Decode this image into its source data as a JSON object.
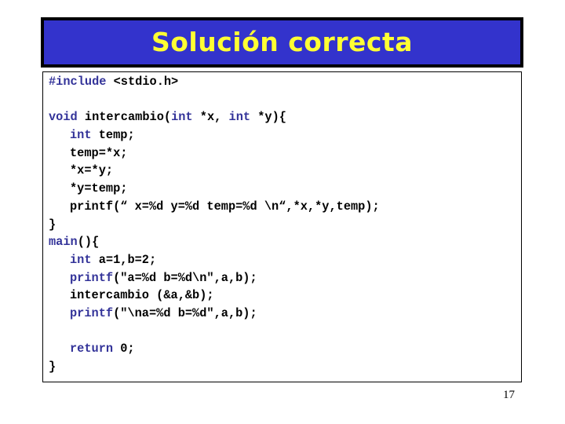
{
  "slide": {
    "title": "Solución correcta",
    "page_number": "17",
    "colors": {
      "title_background": "#3333cc",
      "title_text": "#ffff33",
      "keyword": "#333399",
      "code_text": "#000000"
    }
  },
  "code": {
    "lines": [
      {
        "indent": 0,
        "tokens": [
          {
            "text": "#include",
            "kw": true
          },
          {
            "text": " <stdio.h>",
            "kw": false
          }
        ]
      },
      {
        "indent": 0,
        "tokens": []
      },
      {
        "indent": 0,
        "tokens": [
          {
            "text": "void",
            "kw": true
          },
          {
            "text": " intercambio(",
            "kw": false
          },
          {
            "text": "int",
            "kw": true
          },
          {
            "text": " *x, ",
            "kw": false
          },
          {
            "text": "int",
            "kw": true
          },
          {
            "text": " *y){",
            "kw": false
          }
        ]
      },
      {
        "indent": 1,
        "tokens": [
          {
            "text": "int",
            "kw": true
          },
          {
            "text": " temp;",
            "kw": false
          }
        ]
      },
      {
        "indent": 1,
        "tokens": [
          {
            "text": "temp=*x;",
            "kw": false
          }
        ]
      },
      {
        "indent": 1,
        "tokens": [
          {
            "text": "*x=*y;",
            "kw": false
          }
        ]
      },
      {
        "indent": 1,
        "tokens": [
          {
            "text": "*y=temp;",
            "kw": false
          }
        ]
      },
      {
        "indent": 1,
        "tokens": [
          {
            "text": "printf(“ x=%d y=%d temp=%d \\n“,*x,*y,temp);",
            "kw": false
          }
        ]
      },
      {
        "indent": 0,
        "tokens": [
          {
            "text": "}",
            "kw": false
          }
        ]
      },
      {
        "indent": 0,
        "tokens": [
          {
            "text": "main",
            "kw": true
          },
          {
            "text": "(){",
            "kw": false
          }
        ]
      },
      {
        "indent": 1,
        "tokens": [
          {
            "text": "int",
            "kw": true
          },
          {
            "text": " a=1,b=2;",
            "kw": false
          }
        ]
      },
      {
        "indent": 1,
        "tokens": [
          {
            "text": "printf",
            "kw": true
          },
          {
            "text": "(\"a=%d b=%d\\n\",a,b);",
            "kw": false
          }
        ]
      },
      {
        "indent": 1,
        "tokens": [
          {
            "text": "intercambio (&a,&b);",
            "kw": false
          }
        ]
      },
      {
        "indent": 1,
        "tokens": [
          {
            "text": "printf",
            "kw": true
          },
          {
            "text": "(\"\\na=%d b=%d\",a,b);",
            "kw": false
          }
        ]
      },
      {
        "indent": 0,
        "tokens": []
      },
      {
        "indent": 1,
        "tokens": [
          {
            "text": "return",
            "kw": true
          },
          {
            "text": " 0;",
            "kw": false
          }
        ]
      },
      {
        "indent": 0,
        "tokens": [
          {
            "text": "}",
            "kw": false
          }
        ]
      }
    ]
  }
}
